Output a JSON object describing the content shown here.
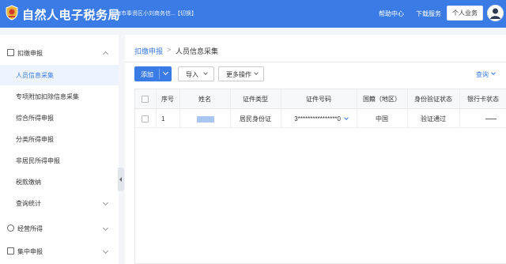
{
  "header": {
    "app_title": "自然人电子税务局",
    "org_name": "上海市奉贤区小刘商务信...",
    "switch_label": "【切换】",
    "help_label": "帮助中心",
    "download_label": "下载服务",
    "business_button": "个人业务",
    "logo_icon": "tax-emblem-icon",
    "avatar_icon": "user-avatar-icon",
    "brand_color": "#3a7be6"
  },
  "sidebar": {
    "groups": [
      {
        "label": "扣缴申报",
        "icon": "form-icon",
        "expanded": true
      },
      {
        "label": "经营所得",
        "icon": "settings-icon",
        "expanded": false
      },
      {
        "label": "集中申报",
        "icon": "play-icon",
        "expanded": false
      }
    ],
    "items": [
      {
        "label": "人员信息采集",
        "active": true
      },
      {
        "label": "专项附加扣除信息采集"
      },
      {
        "label": "综合所得申报"
      },
      {
        "label": "分类所得申报"
      },
      {
        "label": "非居民所得申报"
      },
      {
        "label": "税款缴纳"
      },
      {
        "label": "查询统计"
      }
    ]
  },
  "breadcrumb": {
    "parent": "扣缴申报",
    "separator": ">",
    "current": "人员信息采集"
  },
  "toolbar": {
    "add_label": "添加",
    "import_label": "导入",
    "more_label": "更多操作",
    "query_label": "查询"
  },
  "table": {
    "headers": [
      "序号",
      "姓名",
      "证件类型",
      "证件号码",
      "国籍（地区）",
      "身份验证状态",
      "银行卡状态"
    ],
    "rows": [
      {
        "seq": "1",
        "id_type": "居民身份证",
        "id_number": "3****************0",
        "nationality": "中国",
        "verify_status": "验证通过"
      }
    ]
  }
}
